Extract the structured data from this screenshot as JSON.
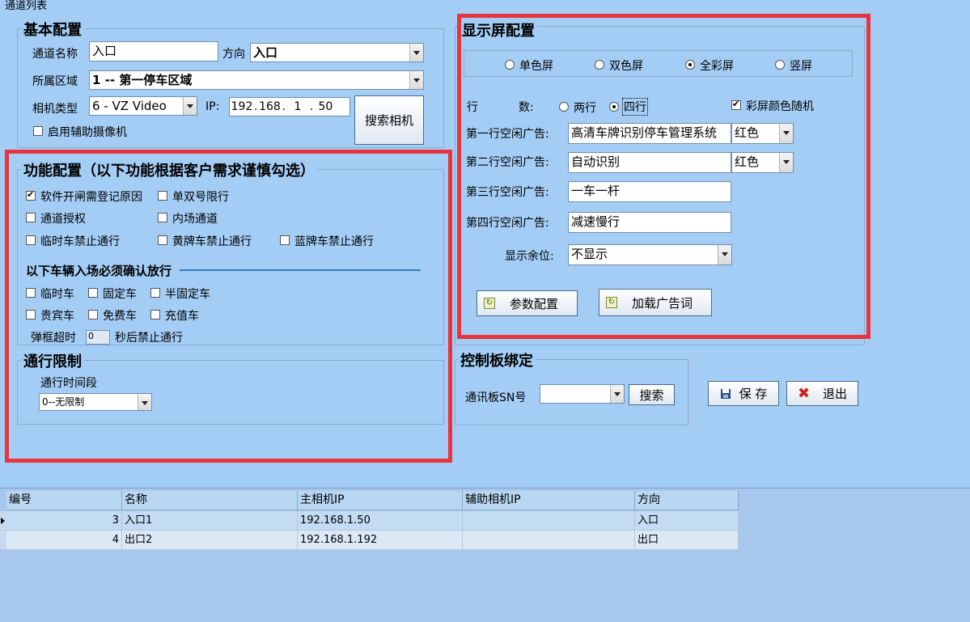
{
  "window": {
    "title": "通道列表"
  },
  "basic": {
    "title": "基本配置",
    "channel_name_label": "通道名称",
    "channel_name_value": "入口",
    "direction_label": "方向",
    "direction_value": "入口",
    "area_label": "所属区域",
    "area_value": "1 -- 第一停车区域",
    "camera_type_label": "相机类型",
    "camera_type_value": "6 - VZ Video",
    "ip_label": "IP:",
    "ip": [
      "192",
      "168",
      "1",
      "50"
    ],
    "search_camera_button": "搜索相机",
    "aux_camera_label": "启用辅助摄像机"
  },
  "function": {
    "title": "功能配置（以下功能根据客户需求谨慎勾选）",
    "reason_label": "软件开闸需登记原因",
    "odd_even_label": "单双号限行",
    "channel_auth_label": "通道授权",
    "inner_channel_label": "内场通道",
    "temp_ban_label": "临时车禁止通行",
    "yellow_ban_label": "黄牌车禁止通行",
    "blue_ban_label": "蓝牌车禁止通行",
    "confirm_title": "以下车辆入场必须确认放行",
    "temp_car": "临时车",
    "fixed_car": "固定车",
    "semi_fixed_car": "半固定车",
    "vip_car": "贵宾车",
    "free_car": "免费车",
    "recharge_car": "充值车",
    "timeout_label": "弹框超时",
    "timeout_value": "0",
    "timeout_suffix": "秒后禁止通行"
  },
  "restrict": {
    "title": "通行限制",
    "period_label": "通行时间段",
    "period_value": "0--无限制"
  },
  "display": {
    "title": "显示屏配置",
    "mono": "单色屏",
    "dual": "双色屏",
    "full": "全彩屏",
    "vertical": "竖屏",
    "rows_label_a": "行",
    "rows_label_b": "数:",
    "two_rows": "两行",
    "four_rows": "四行",
    "random_color": "彩屏颜色随机",
    "line1_label": "第一行空闲广告:",
    "line1_value": "高清车牌识别停车管理系统",
    "line1_color": "红色",
    "line2_label": "第二行空闲广告:",
    "line2_value": "自动识别",
    "line2_color": "红色",
    "line3_label": "第三行空闲广告:",
    "line3_value": "一车一杆",
    "line4_label": "第四行空闲广告:",
    "line4_value": "减速慢行",
    "remain_label": "显示余位:",
    "remain_value": "不显示",
    "param_button": "参数配置",
    "load_ads_button": "加载广告词"
  },
  "control": {
    "title": "控制板绑定",
    "sn_label": "通讯板SN号",
    "sn_value": "",
    "search_button": "搜索"
  },
  "actions": {
    "save": "保 存",
    "exit": "退出"
  },
  "grid": {
    "headers": [
      "编号",
      "名称",
      "主相机IP",
      "辅助相机IP",
      "方向"
    ],
    "rows": [
      [
        "3",
        "入口1",
        "192.168.1.50",
        "",
        "入口"
      ],
      [
        "4",
        "出口2",
        "192.168.1.192",
        "",
        "出口"
      ]
    ]
  },
  "colors": {
    "background": "#a4cdf5",
    "highlight": "#e8343c"
  }
}
